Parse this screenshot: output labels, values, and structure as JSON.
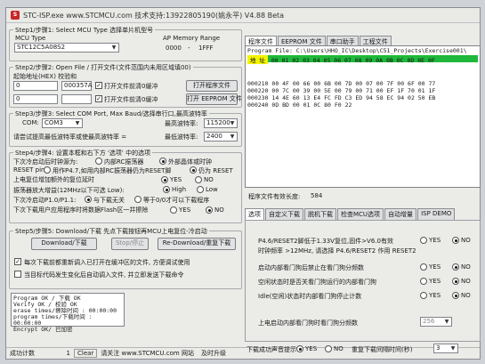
{
  "window": {
    "title": "STC-ISP.exe    www.STCMCU.com    技术支持:13922805190(姚永平)    V4.88 Beta"
  },
  "step1": {
    "title": "Step1/步骤1: Select MCU Type  选择单片机型号",
    "mcu_type_label": "MCU Type",
    "mcu_type": "STC12C5A08S2",
    "ap_label": "AP Memory Range",
    "ap_start": "0000",
    "ap_end": "1FFF"
  },
  "step2": {
    "title": "Step2/步骤2: Open File / 打开文件(文件范围内未用区域填00)",
    "start_label": "起始地址(HEX) 校验和",
    "addr1": "0",
    "checksum1": "000357A",
    "check1_label": "打开文件前清0缓冲",
    "open_program": "打开程序文件",
    "addr2": "0",
    "check2_label": "打开文件前清0缓冲",
    "open_eeprom": "打开 EEPROM 文件"
  },
  "step3": {
    "title": "Step3/步骤3: Select COM Port, Max Baud/选择串行口,最高波特率",
    "com_label": "COM:",
    "com_value": "COM3",
    "max_baud_label": "最高波特率:",
    "max_baud": "115200",
    "min_label": "请尝试提高最低波特率或使最高波特率 =",
    "min_baud_label": "最低波特率:",
    "min_baud": "2400"
  },
  "step4": {
    "title": "Step4/步骤4: 设置本框和右下方 '选项' 中的选项",
    "row1": "下次冷启动后时钟源为:",
    "row1a": "内部RC振荡器",
    "row1b": "外部晶体或时钟",
    "row2": "RESET pin",
    "row2a": "用作P4.7,如用内部RC振荡器仍为RESET脚",
    "row2b": "仍为 RESET",
    "row3": "上电复位增加额外的复位延时",
    "yes": "YES",
    "no": "NO",
    "row4": "振荡器放大增益(12MHz以下可选 Low):",
    "high": "High",
    "low": "Low",
    "row5": "下次冷启动P1.0/P1.1:",
    "row5a": "与下载无关",
    "row5b": "等于0/0才可以下载程序",
    "row6": "下次下载用户应用程序时将数据Flash区一并擦除"
  },
  "step5": {
    "title": "Step5/步骤5: Download/下载  先点下载按钮再MCU上电复位-冷启动",
    "download": "Download/下载",
    "stop": "Stop/停止",
    "redownload": "Re-Download/重复下载",
    "check1": "每次下载前都重新调入已打开在缓冲区的文件, 方便调试使用",
    "check2": "当目标代码发生变化后自动调入文件, 并立即发送下载命令"
  },
  "log": [
    "Program OK / 下载 OK",
    "Verify  OK / 校验 OK",
    "erase times/擦除时间 : 00:00:00",
    "program times/下载时间 : 00:00:00",
    "Encrypt OK/ 已加密"
  ],
  "status": {
    "count_label": "成功计数",
    "count": "1",
    "clear": "Clear",
    "link": "请关注 www.STCMCU.com 网站",
    "extra": "及时升级"
  },
  "right": {
    "tabs": [
      "程序文件",
      "EEPROM 文件",
      "串口助手",
      "工程文件"
    ],
    "program_file": "Program File: C:\\Users\\HHO_IC\\Desktop\\C51_Projects\\Exercise001\\",
    "hex_head_addr": "地 址",
    "hex_head": "00 01 02 03 04 05 06 07 08 09 0A 0B 0C 0D 0E 0F",
    "hex_rows": [
      {
        "addr": "000210",
        "bytes": "00 4F 00 66 00 6B 00 7D 00 07 00 7F 00 6F 00 77"
      },
      {
        "addr": "000220",
        "bytes": "00 7C 00 39 00 5E 00 79 00 71 00 EF 1F 70 01 1F"
      },
      {
        "addr": "000230",
        "bytes": "14 4E 60 13 E4 FC FD C3 ED 94 58 EC 94 02 50 EB"
      },
      {
        "addr": "000240",
        "bytes": "0D BD 00 01 0C 80 F0 22"
      }
    ],
    "checksum_label": "程序文件有效长度:",
    "checksum": "584",
    "option_tabs": [
      "选项",
      "自定义下载",
      "脱机下载",
      "检查MCU选项",
      "自动增量",
      "ISP DEMO"
    ],
    "opt1": "P4.6/RESET2脚低于1.33V复位,固件>V6.0有效",
    "opt1_sub": "时钟频率 >12MHz, 请选择 P4.6/RESET2 作用 RESET2",
    "opt2": "启动内部看门狗后禁止在看门狗分频数",
    "opt3": "空闲状态时是否关看门狗运行的内部看门狗",
    "opt4": "Idle(空闲)状态时内部看门狗停止计数",
    "opt5": "上电启动内部看门狗时看门狗分频数",
    "opt5_val": "256",
    "bottom_label": "下载成功声音提示",
    "bottom_label2": "重复下载间隔时间(秒)",
    "bottom_val": "3"
  }
}
